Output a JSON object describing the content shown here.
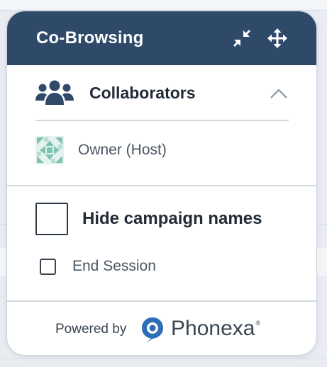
{
  "widget": {
    "title": "Co-Browsing",
    "minimize_icon": "minimize-arrows-icon",
    "move_icon": "move-arrows-icon"
  },
  "collaborators": {
    "heading": "Collaborators",
    "expanded": true,
    "users": [
      {
        "label": "Owner (Host)",
        "avatar": "quilt-pattern-avatar"
      }
    ]
  },
  "options": {
    "hide_campaign_names": {
      "label": "Hide campaign names",
      "checked": false
    },
    "end_session": {
      "label": "End Session",
      "checked": false
    }
  },
  "footer": {
    "powered_by": "Powered by",
    "brand": "Phonexa",
    "registered_mark": "®"
  },
  "colors": {
    "header_bg": "#2f4a69",
    "accent_blue": "#2d6fb5",
    "avatar_teal": "#7cc3b4"
  }
}
